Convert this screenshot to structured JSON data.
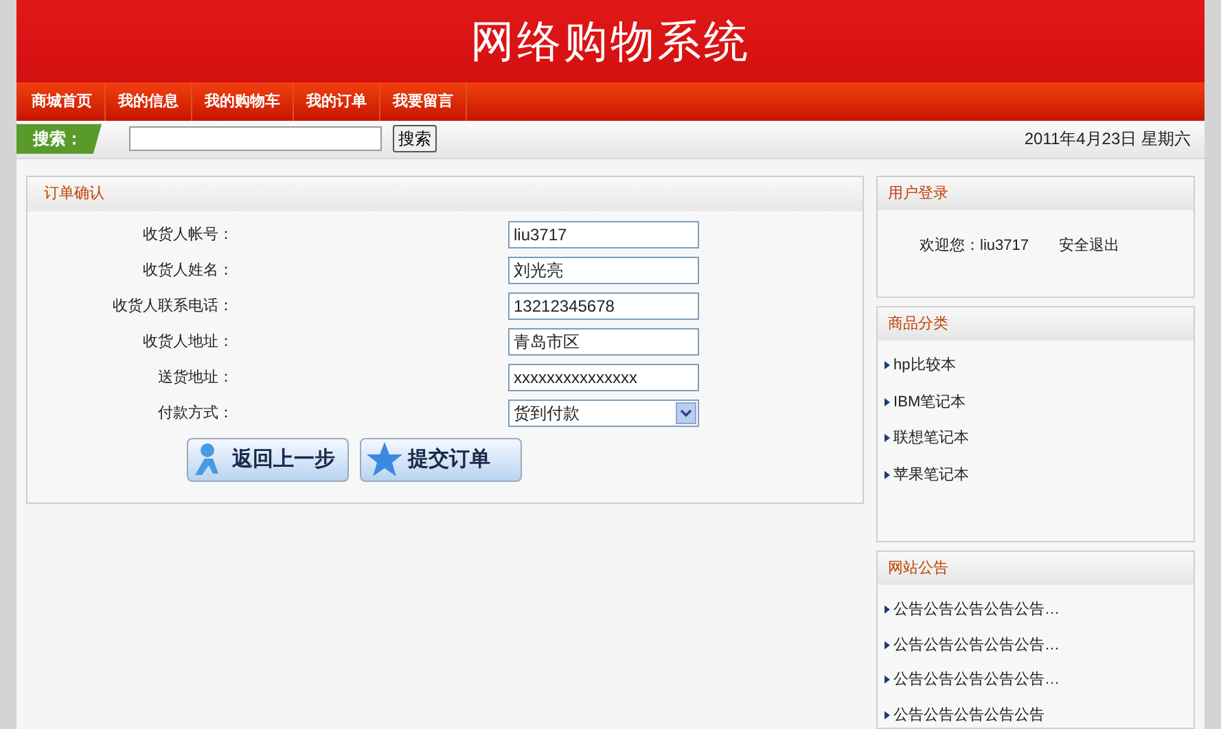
{
  "header": {
    "title": "网络购物系统"
  },
  "nav": [
    {
      "label": "商城首页"
    },
    {
      "label": "我的信息"
    },
    {
      "label": "我的购物车"
    },
    {
      "label": "我的订单"
    },
    {
      "label": "我要留言"
    }
  ],
  "search": {
    "label": "搜索：",
    "button": "搜索",
    "date": "2011年4月23日 星期六"
  },
  "order": {
    "title": "订单确认",
    "fields": [
      {
        "label": "收货人帐号：",
        "value": "liu3717",
        "kind": "text"
      },
      {
        "label": "收货人姓名：",
        "value": "刘光亮",
        "kind": "text"
      },
      {
        "label": "收货人联系电话：",
        "value": "13212345678",
        "kind": "text"
      },
      {
        "label": "收货人地址：",
        "value": "青岛市区",
        "kind": "text"
      },
      {
        "label": "送货地址：",
        "value": "xxxxxxxxxxxxxxx",
        "kind": "text"
      },
      {
        "label": "付款方式：",
        "value": "货到付款",
        "kind": "select"
      }
    ],
    "buttons": [
      {
        "label": "返回上一步",
        "kind": "back"
      },
      {
        "label": "提交订单",
        "kind": "submit"
      }
    ]
  },
  "login": {
    "title": "用户登录",
    "welcome": "欢迎您：liu3717",
    "logout": "安全退出"
  },
  "categories": {
    "title": "商品分类",
    "items": [
      "hp比较本",
      "IBM笔记本",
      "联想笔记本",
      "苹果笔记本"
    ]
  },
  "notices": {
    "title": "网站公告",
    "items": [
      "公告公告公告公告公告…",
      "公告公告公告公告公告…",
      "公告公告公告公告公告…",
      "公告公告公告公告公告"
    ]
  }
}
